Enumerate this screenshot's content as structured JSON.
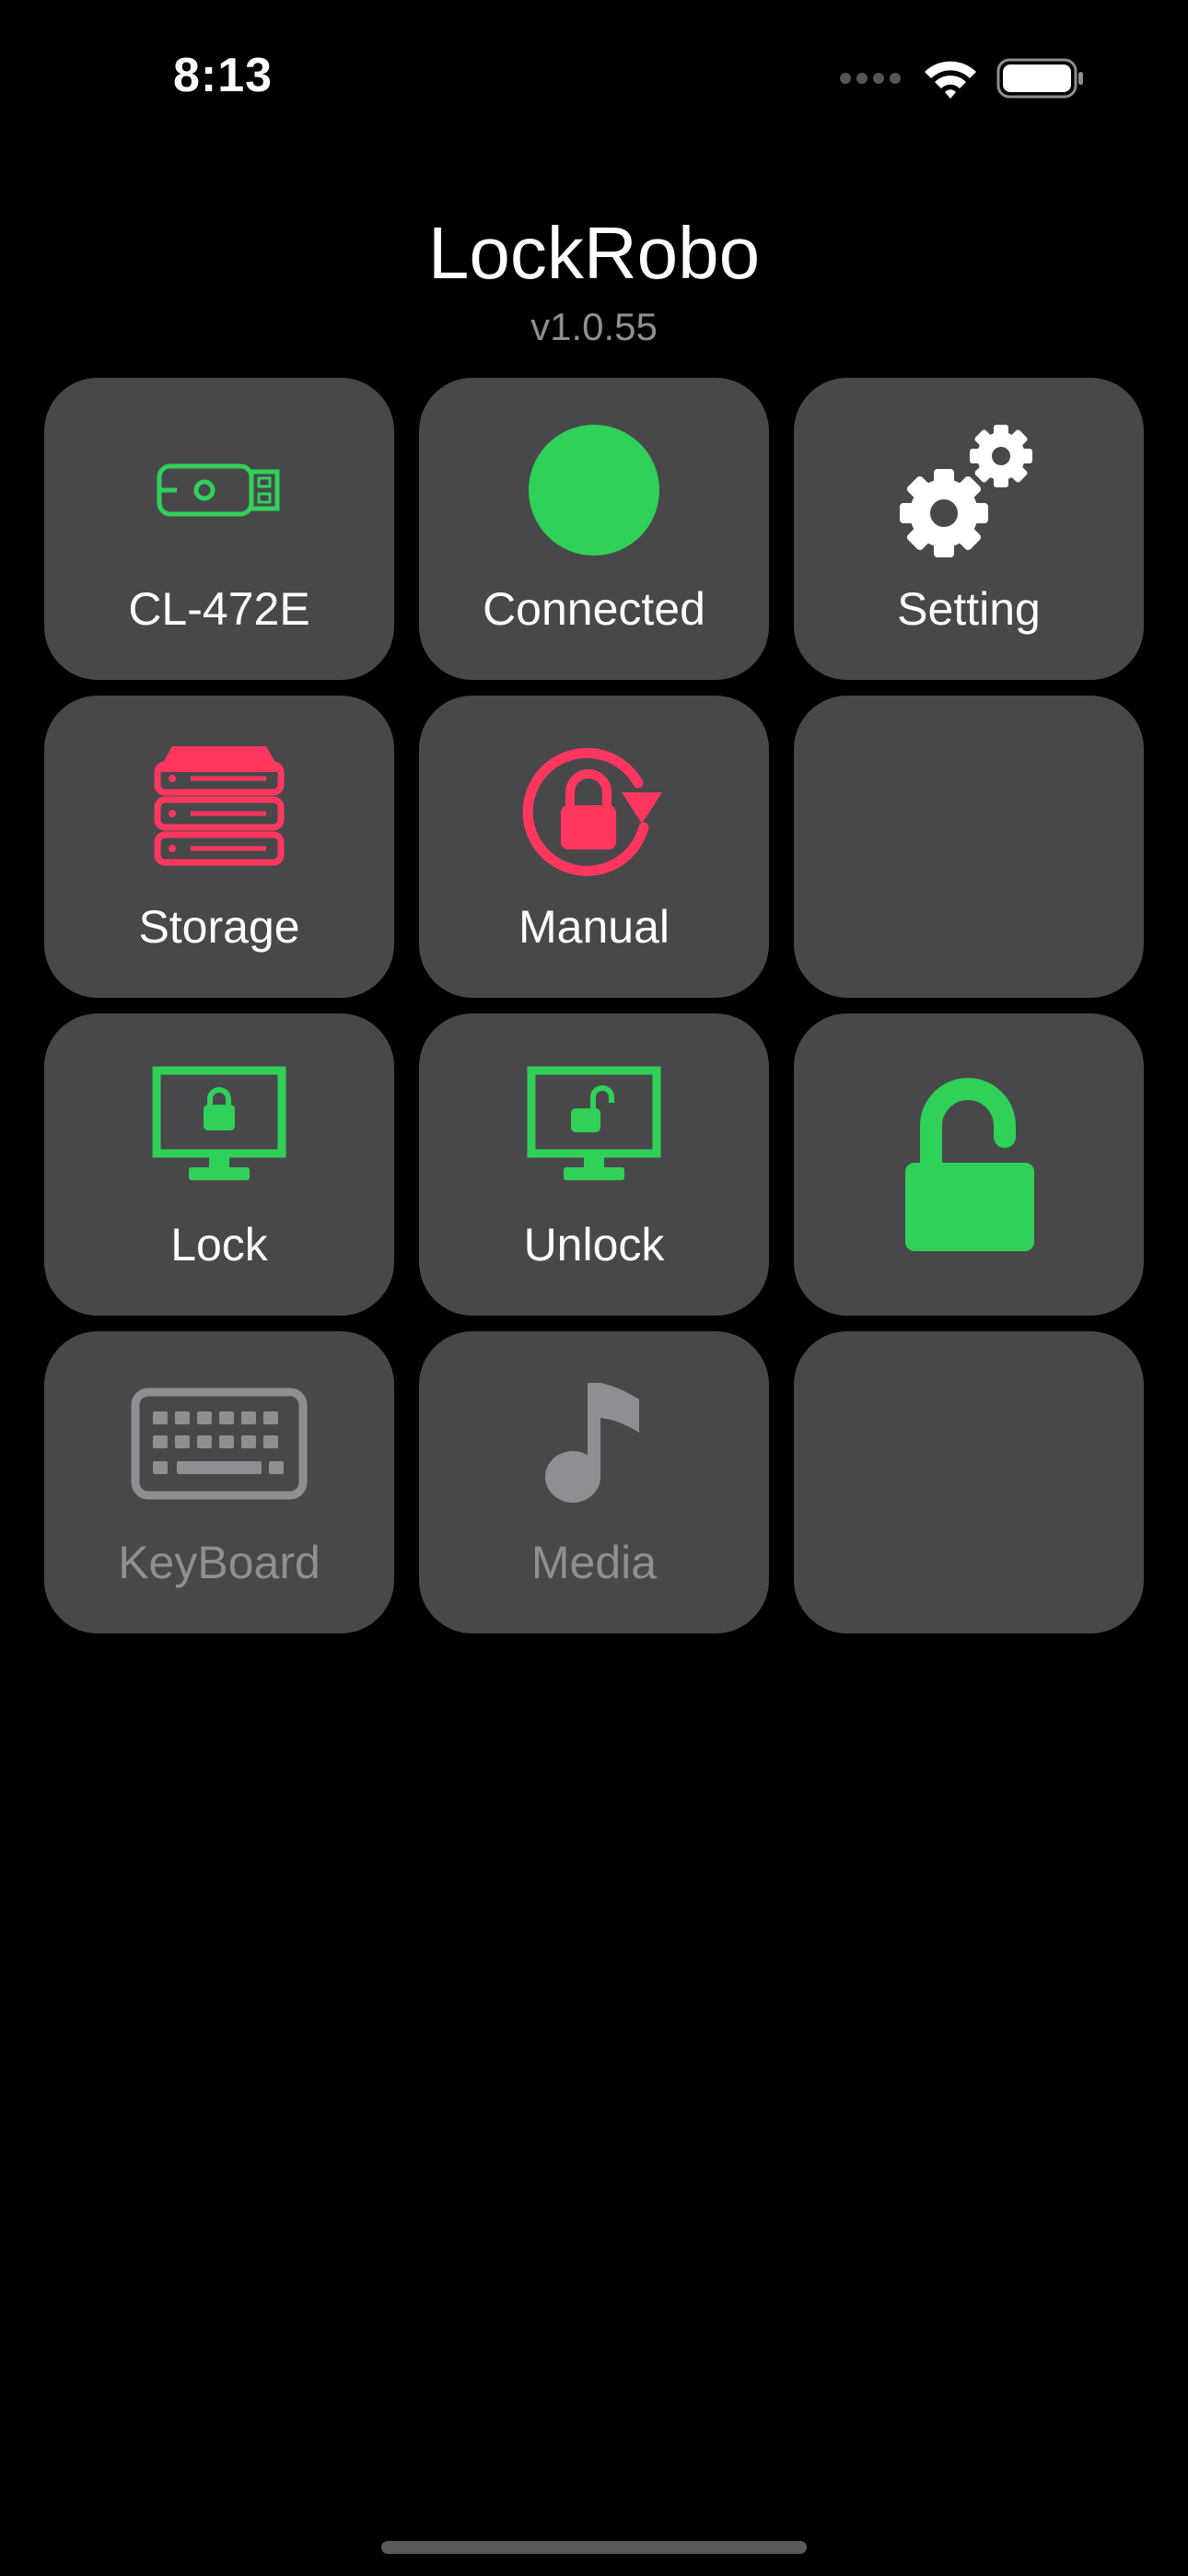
{
  "status_bar": {
    "time": "8:13",
    "icons": [
      "signal-dots-icon",
      "wifi-icon",
      "battery-icon"
    ]
  },
  "header": {
    "title": "LockRobo",
    "version": "v1.0.55"
  },
  "colors": {
    "background": "#000000",
    "tile": "#48484a",
    "green": "#30d158",
    "red": "#ff375f",
    "gray": "#8e8e93",
    "white": "#ffffff"
  },
  "tiles": [
    {
      "label": "CL-472E",
      "icon": "usb-drive-icon"
    },
    {
      "label": "Connected",
      "icon": "status-dot-icon"
    },
    {
      "label": "Setting",
      "icon": "gears-icon"
    },
    {
      "label": "Storage",
      "icon": "storage-stack-icon"
    },
    {
      "label": "Manual",
      "icon": "lock-rotate-icon"
    },
    {
      "label": "",
      "icon": ""
    },
    {
      "label": "Lock",
      "icon": "monitor-lock-icon"
    },
    {
      "label": "Unlock",
      "icon": "monitor-unlock-icon"
    },
    {
      "label": "",
      "icon": "open-padlock-icon"
    },
    {
      "label": "KeyBoard",
      "icon": "keyboard-icon"
    },
    {
      "label": "Media",
      "icon": "music-note-icon"
    },
    {
      "label": "",
      "icon": ""
    }
  ]
}
